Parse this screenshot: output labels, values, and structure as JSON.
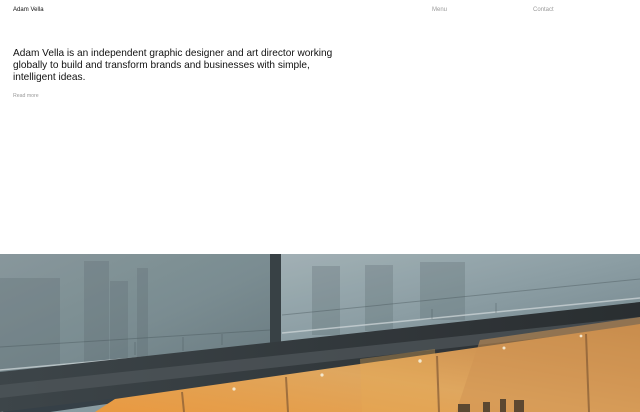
{
  "header": {
    "brand": "Adam Vella",
    "nav": {
      "menu_label": "Menu",
      "contact_label": "Contact"
    }
  },
  "intro": {
    "text": "Adam Vella is an independent graphic designer and art director working globally to build and transform brands and businesses with simple, intelligent ideas.",
    "read_more_label": "Read more"
  }
}
